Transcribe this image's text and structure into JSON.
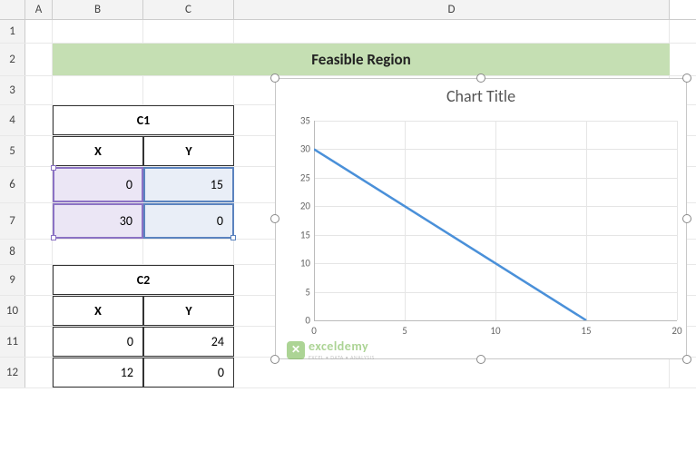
{
  "columns": [
    "A",
    "B",
    "C",
    "D"
  ],
  "rows": [
    "1",
    "2",
    "3",
    "4",
    "5",
    "6",
    "7",
    "8",
    "9",
    "10",
    "11",
    "12"
  ],
  "banner": "Feasible Region",
  "tableC1": {
    "name": "C1",
    "col_x": "X",
    "col_y": "Y",
    "r1x": "0",
    "r1y": "15",
    "r2x": "30",
    "r2y": "0"
  },
  "tableC2": {
    "name": "C2",
    "col_x": "X",
    "col_y": "Y",
    "r1x": "0",
    "r1y": "24",
    "r2x": "12",
    "r2y": "0"
  },
  "chart": {
    "title": "Chart Title",
    "y_ticks": [
      "0",
      "5",
      "10",
      "15",
      "20",
      "25",
      "30",
      "35"
    ],
    "x_ticks": [
      "0",
      "5",
      "10",
      "15",
      "20"
    ]
  },
  "watermark": {
    "brand": "exceldemy",
    "sub": "EXCEL • DATA • ANALYSIS"
  },
  "chart_data": {
    "type": "line",
    "title": "Chart Title",
    "xlabel": "",
    "ylabel": "",
    "xlim": [
      0,
      20
    ],
    "ylim": [
      0,
      35
    ],
    "series": [
      {
        "name": "Y",
        "x": [
          0,
          30
        ],
        "y": [
          15,
          0
        ],
        "visible_x": [
          0,
          15
        ],
        "visible_y": [
          30,
          0
        ]
      }
    ]
  }
}
